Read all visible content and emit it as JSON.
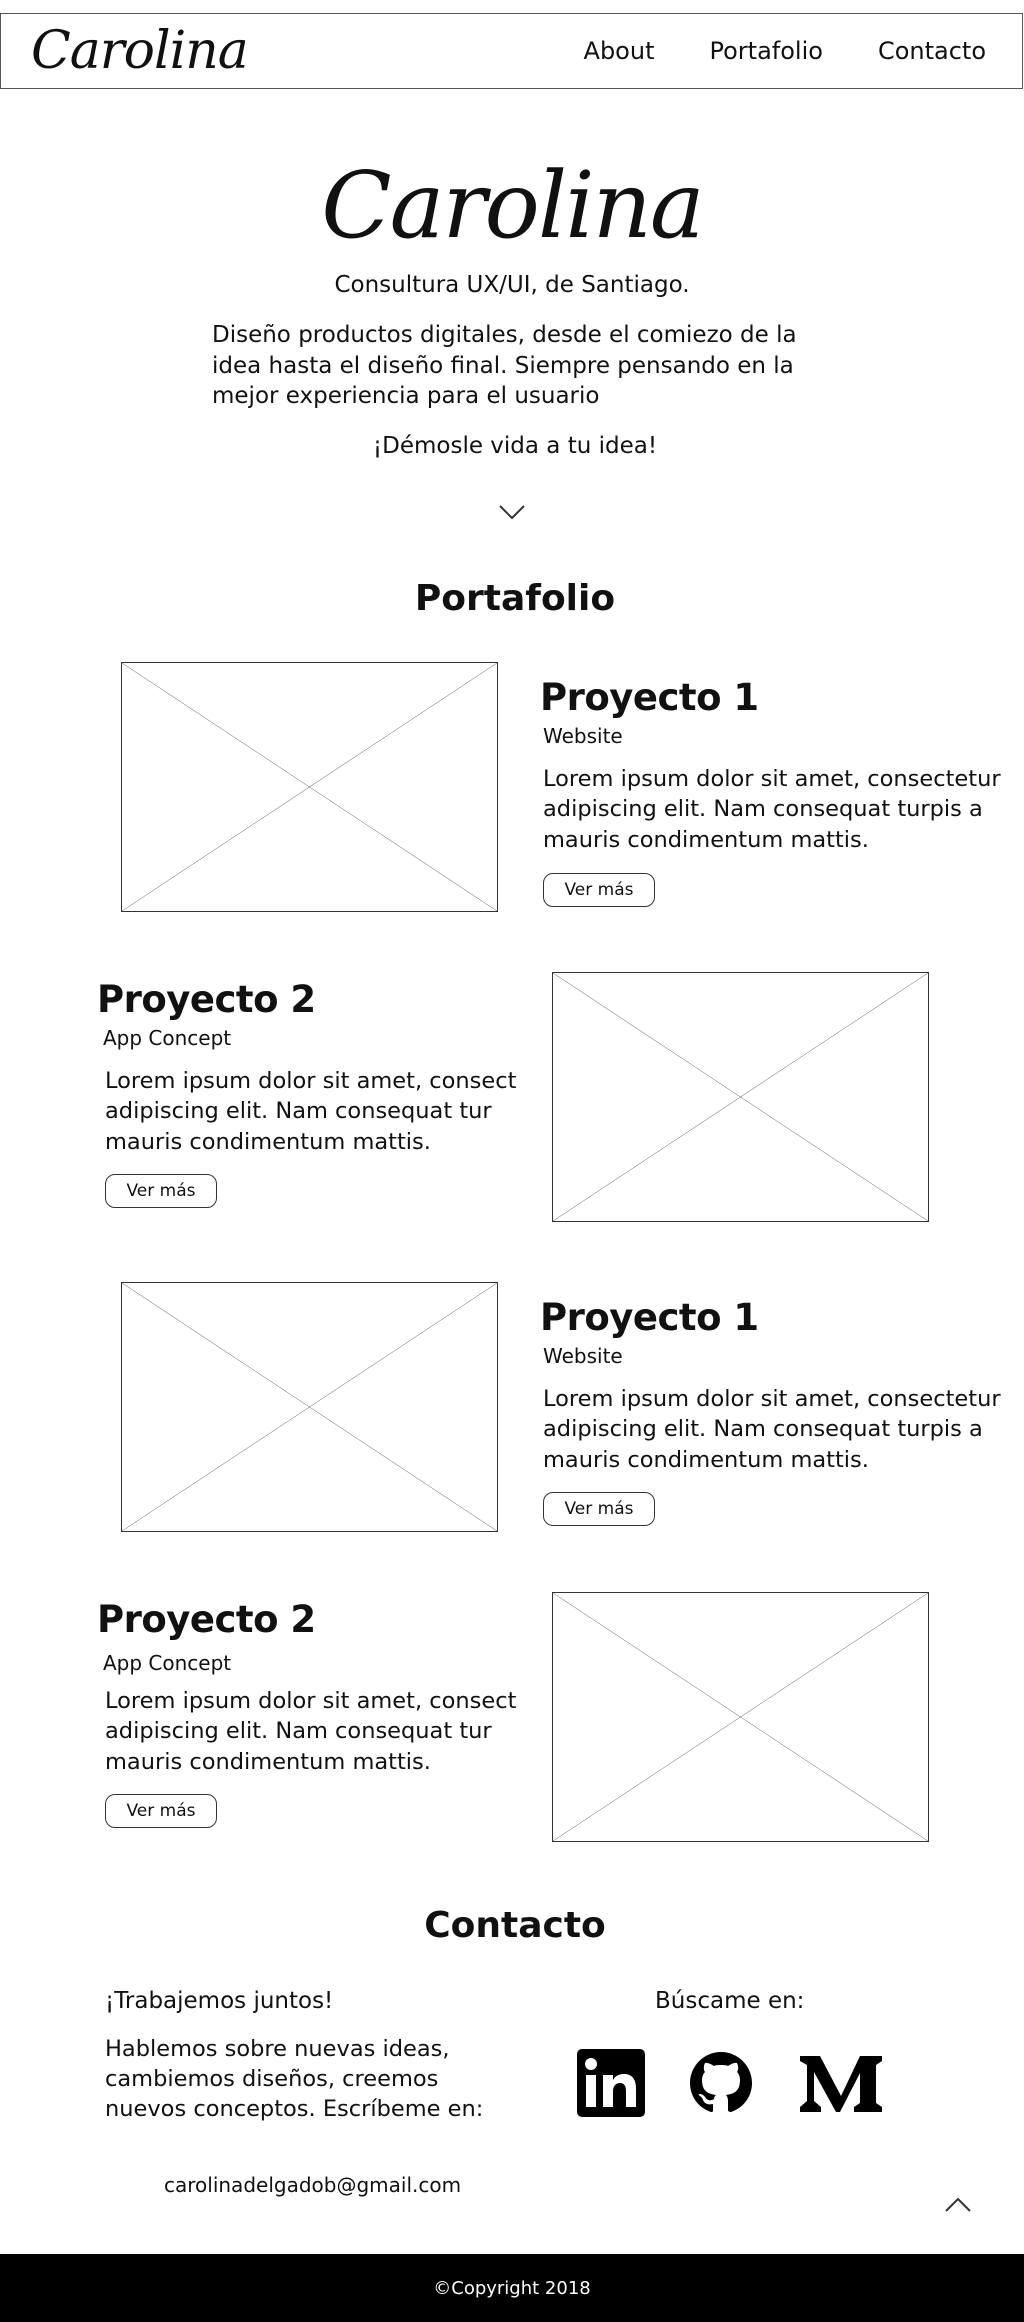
{
  "nav": {
    "brand": "Carolina",
    "links": [
      "About",
      "Portafolio",
      "Contacto"
    ]
  },
  "hero": {
    "title": "Carolina",
    "subtitle": "Consultura UX/UI, de Santiago.",
    "description": "Diseño productos digitales, desde el comiezo de la idea hasta el diseño final. Siempre pensando en la mejor experiencia para el usuario",
    "cta": "¡Démosle vida a tu idea!",
    "scroll_icon": "chevron-down-icon"
  },
  "portfolio": {
    "title": "Portafolio",
    "projects": [
      {
        "title": "Proyecto 1",
        "type": "Website",
        "description": "Lorem ipsum dolor sit amet, consectetur adipiscing elit. Nam consequat turpis a mauris condimentum mattis.",
        "button": "Ver más"
      },
      {
        "title": "Proyecto 2",
        "type": "App Concept",
        "description": "Lorem ipsum dolor sit amet, consect adipiscing elit. Nam consequat tur mauris condimentum mattis.",
        "button": "Ver más"
      },
      {
        "title": "Proyecto 1",
        "type": "Website",
        "description": "Lorem ipsum dolor sit amet, consectetur adipiscing elit. Nam consequat turpis a mauris condimentum mattis.",
        "button": "Ver más"
      },
      {
        "title": "Proyecto 2",
        "type": "App Concept",
        "description": "Lorem ipsum dolor sit amet, consect adipiscing elit. Nam consequat tur mauris condimentum mattis.",
        "button": "Ver más"
      }
    ]
  },
  "contact": {
    "title": "Contacto",
    "lead": "¡Trabajemos juntos!",
    "description": "Hablemos sobre nuevas ideas, cambiemos diseños, creemos nuevos conceptos. Escríbeme en:",
    "email": "carolinadelgadob@gmail.com",
    "find_me": "Búscame en:",
    "social_icons": [
      "linkedin-icon",
      "github-icon",
      "medium-icon"
    ],
    "scroll_icon": "chevron-up-icon"
  },
  "footer": {
    "copyright": "©Copyright 2018"
  }
}
